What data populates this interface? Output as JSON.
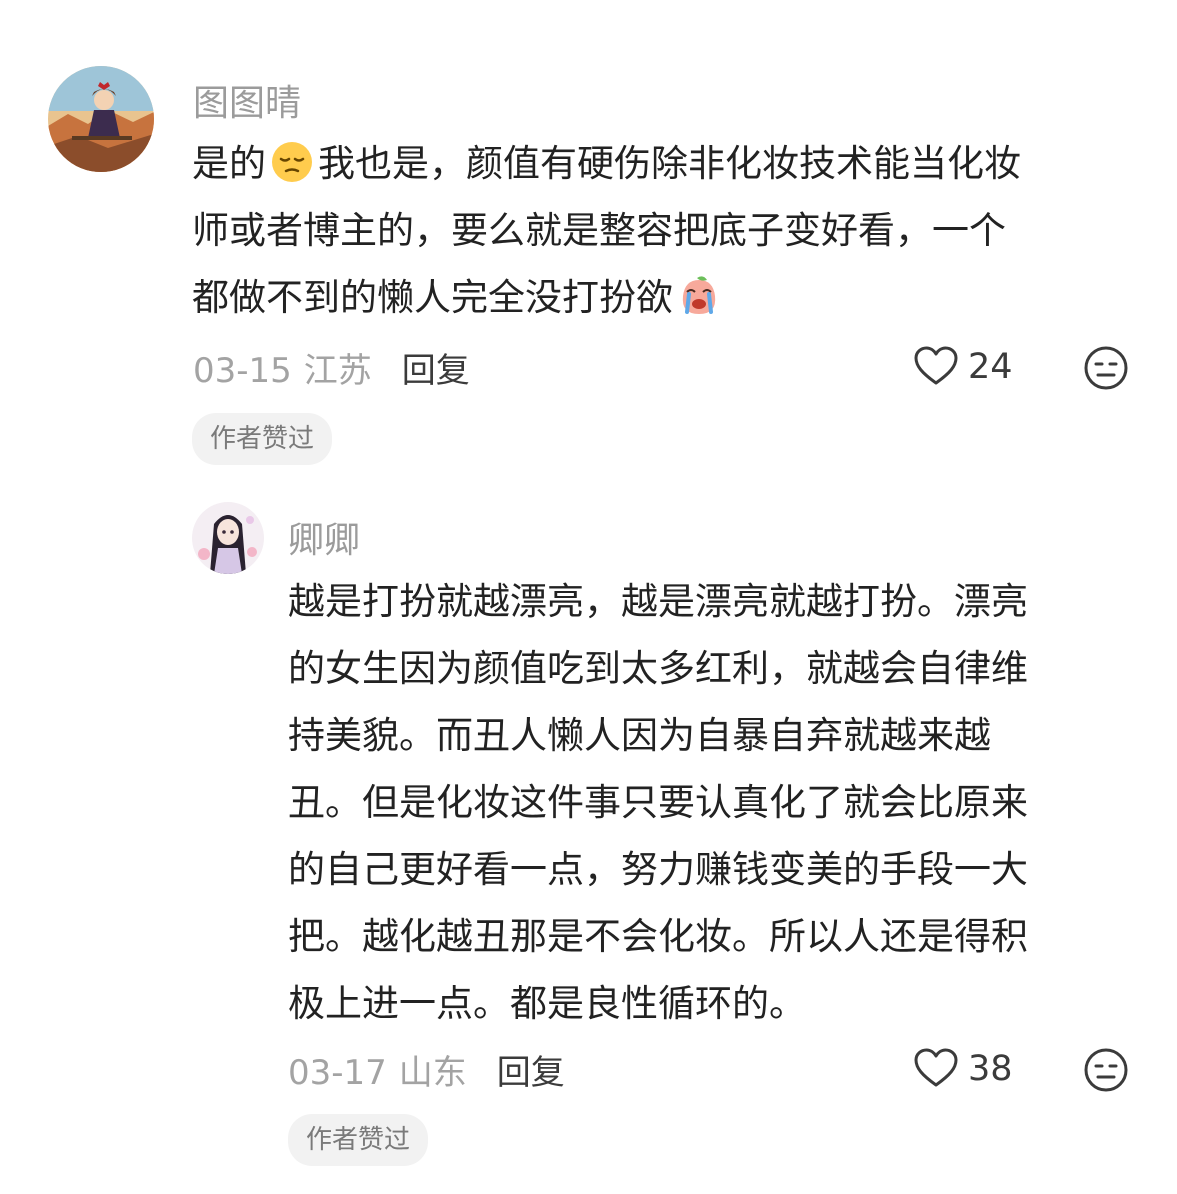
{
  "comments": [
    {
      "username": "图图晴",
      "avatar_icon": "anime-girl-avatar-icon",
      "text_lines": [
        {
          "before": "是的",
          "emoji": "pensive-face-icon",
          "after": "我也是，颜值有硬伤除非化妆技术能当化妆"
        },
        {
          "before": "师或者博主的，要么就是整容把底子变好看，一个",
          "emoji": "",
          "after": ""
        },
        {
          "before": "都做不到的懒人完全没打扮欲",
          "emoji": "crying-peach-icon",
          "after": ""
        }
      ],
      "date": "03-15",
      "location": "江苏",
      "reply_label": "回复",
      "like_count": "24",
      "badge": "作者赞过"
    },
    {
      "username": "卿卿",
      "avatar_icon": "long-hair-girl-avatar-icon",
      "text_lines": [
        "越是打扮就越漂亮，越是漂亮就越打扮。漂亮",
        "的女生因为颜值吃到太多红利，就越会自律维",
        "持美貌。而丑人懒人因为自暴自弃就越来越",
        "丑。但是化妆这件事只要认真化了就会比原来",
        "的自己更好看一点，努力赚钱变美的手段一大",
        "把。越化越丑那是不会化妆。所以人还是得积",
        "极上进一点。都是良性循环的。"
      ],
      "date": "03-17",
      "location": "山东",
      "reply_label": "回复",
      "like_count": "38",
      "badge": "作者赞过"
    }
  ],
  "icons": {
    "like": "heart-outline-icon",
    "dislike": "neutral-face-icon"
  },
  "colors": {
    "text": "#222222",
    "secondary": "#9b9b9b",
    "badge_bg": "#f2f2f2"
  }
}
